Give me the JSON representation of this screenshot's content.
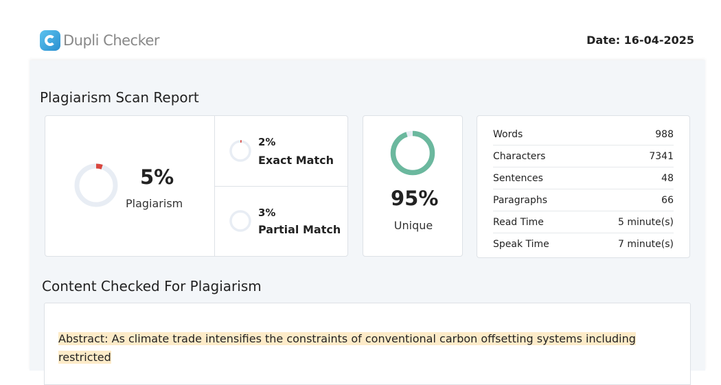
{
  "header": {
    "logo_text": "Dupli Checker",
    "date": "Date: 16-04-2025"
  },
  "report": {
    "title": "Plagiarism Scan Report",
    "plagiarism": {
      "value": "5%",
      "label": "Plagiarism",
      "fraction": 0.05
    },
    "exact": {
      "value": "2%",
      "label": "Exact Match",
      "fraction": 0.02
    },
    "partial": {
      "value": "3%",
      "label": "Partial Match",
      "fraction": 0.03
    },
    "unique": {
      "value": "95%",
      "label": "Unique",
      "fraction": 0.95
    },
    "stats": [
      {
        "label": "Words",
        "value": "988"
      },
      {
        "label": "Characters",
        "value": "7341"
      },
      {
        "label": "Sentences",
        "value": "48"
      },
      {
        "label": "Paragraphs",
        "value": "66"
      },
      {
        "label": "Read Time",
        "value": "5 minute(s)"
      },
      {
        "label": "Speak Time",
        "value": "7 minute(s)"
      }
    ]
  },
  "content": {
    "title": "Content Checked For Plagiarism",
    "text_line1": "Abstract: As climate trade intensifies the constraints of conventional carbon offsetting systems including",
    "text_line2": "restricted"
  },
  "colors": {
    "plagiarism": "#d9463e",
    "unique": "#6bb89e",
    "ring_track": "#e8edf4"
  }
}
